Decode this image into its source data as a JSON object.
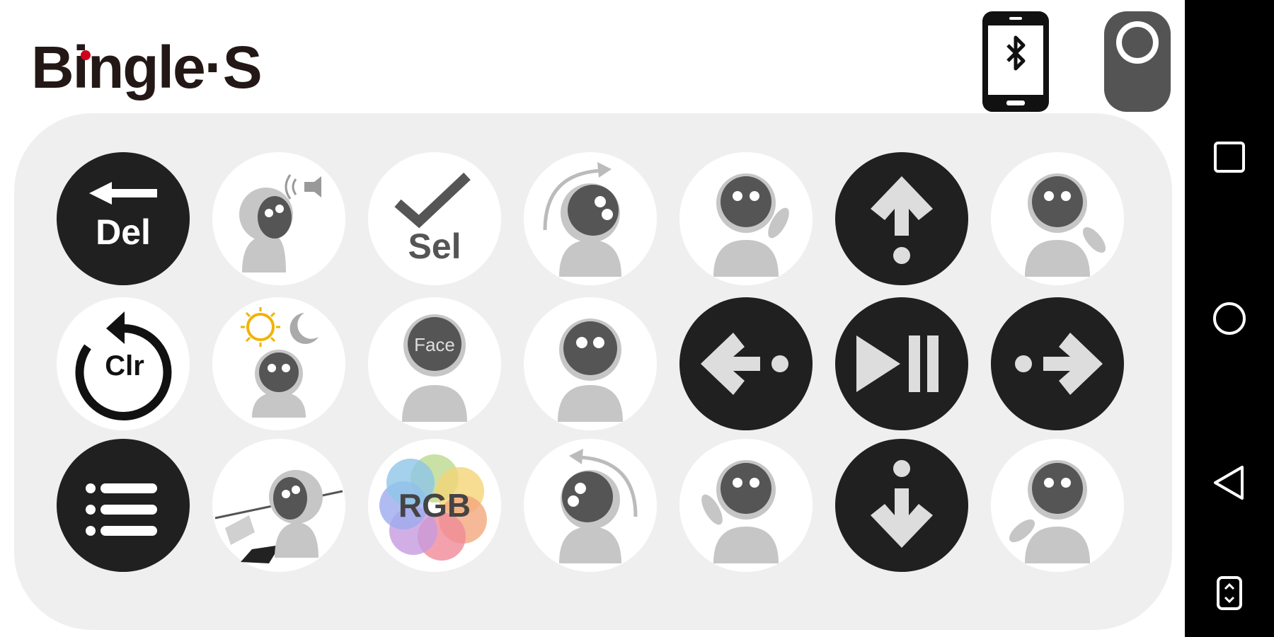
{
  "app": {
    "logo_text": "Bingle·S",
    "bluetooth_icon": "bluetooth-phone-icon",
    "camera_icon": "camera-toggle-icon"
  },
  "buttons": {
    "del_label": "Del",
    "sel_label": "Sel",
    "clr_label": "Clr",
    "face_label": "Face",
    "rgb_label": "RGB"
  },
  "icons": [
    "delete-icon",
    "speaker-robot-icon",
    "select-check-icon",
    "rotate-right-robot-icon",
    "wave-right-robot-icon",
    "arrow-up-icon",
    "swing-right-robot-icon",
    "clear-icon",
    "day-night-robot-icon",
    "face-robot-icon",
    "plain-robot-icon",
    "arrow-left-icon",
    "play-pause-icon",
    "arrow-right-icon",
    "menu-list-icon",
    "line-follow-robot-icon",
    "rgb-color-icon",
    "rotate-left-robot-icon",
    "wave-left-robot-icon",
    "arrow-down-icon",
    "swing-left-robot-icon"
  ],
  "colors": {
    "dark_button": "#212021",
    "panel": "#efefef",
    "robot_head": "#555555",
    "robot_body": "#c6c6c7",
    "logo_dot": "#d0021b"
  },
  "nav": {
    "recents_icon": "square-icon",
    "home_icon": "circle-icon",
    "back_icon": "triangle-back-icon",
    "extra_icon": "accessibility-icon"
  }
}
